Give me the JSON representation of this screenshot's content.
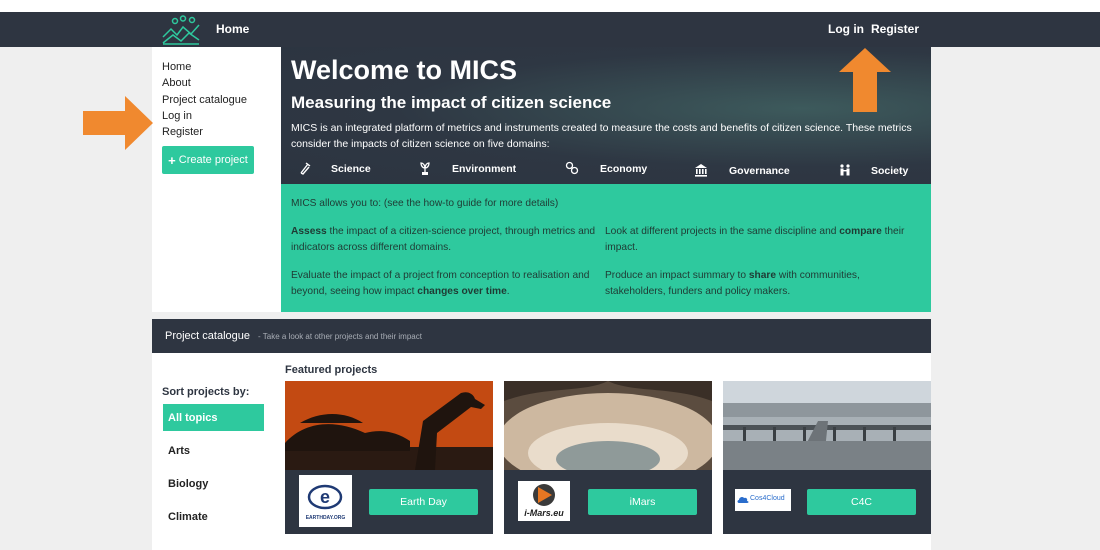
{
  "navbar": {
    "home": "Home",
    "login": "Log in",
    "register": "Register"
  },
  "sidebar": {
    "links": [
      "Home",
      "About",
      "Project catalogue",
      "Log in",
      "Register"
    ],
    "create_project": "Create project"
  },
  "hero": {
    "title": "Welcome to MICS",
    "subtitle": "Measuring the impact of citizen science",
    "description": "MICS is an integrated platform of metrics and instruments created to measure the costs and benefits of citizen science. These metrics consider the impacts of citizen science on five domains:",
    "domains": [
      {
        "label": "Science",
        "icon": "flask-icon"
      },
      {
        "label": "Environment",
        "icon": "plant-icon"
      },
      {
        "label": "Economy",
        "icon": "coins-icon"
      },
      {
        "label": "Governance",
        "icon": "building-icon"
      },
      {
        "label": "Society",
        "icon": "people-icon"
      }
    ]
  },
  "info": {
    "intro": "MICS allows you to: (see the how-to guide for more details)",
    "assess_bold": "Assess",
    "assess_rest": " the impact of a citizen-science project, through metrics and indicators across different domains.",
    "compare_pre": "Look at different projects in the same discipline and ",
    "compare_bold": "compare",
    "compare_post": " their impact.",
    "evaluate_pre": "Evaluate the impact of a project from conception to realisation and beyond, seeing how impact ",
    "evaluate_bold": "changes over time",
    "evaluate_post": ".",
    "share_pre": "Produce an impact summary to ",
    "share_bold": "share",
    "share_post": " with communities, stakeholders, funders and policy makers."
  },
  "catalogue": {
    "title": "Project catalogue",
    "subtitle": "- Take a look at other projects and their impact",
    "featured": "Featured projects",
    "sort_label": "Sort projects by:",
    "topics": [
      "All topics",
      "Arts",
      "Biology",
      "Climate"
    ],
    "projects": [
      {
        "name": "Earth Day",
        "logo_text": "EARTHDAY.ORG"
      },
      {
        "name": "iMars",
        "logo_text": "i-Mars.eu"
      },
      {
        "name": "C4C",
        "logo_text": "Cos4Cloud"
      }
    ]
  },
  "colors": {
    "dark": "#2e3541",
    "accent": "#2ec99e",
    "arrow": "#f0892f"
  }
}
